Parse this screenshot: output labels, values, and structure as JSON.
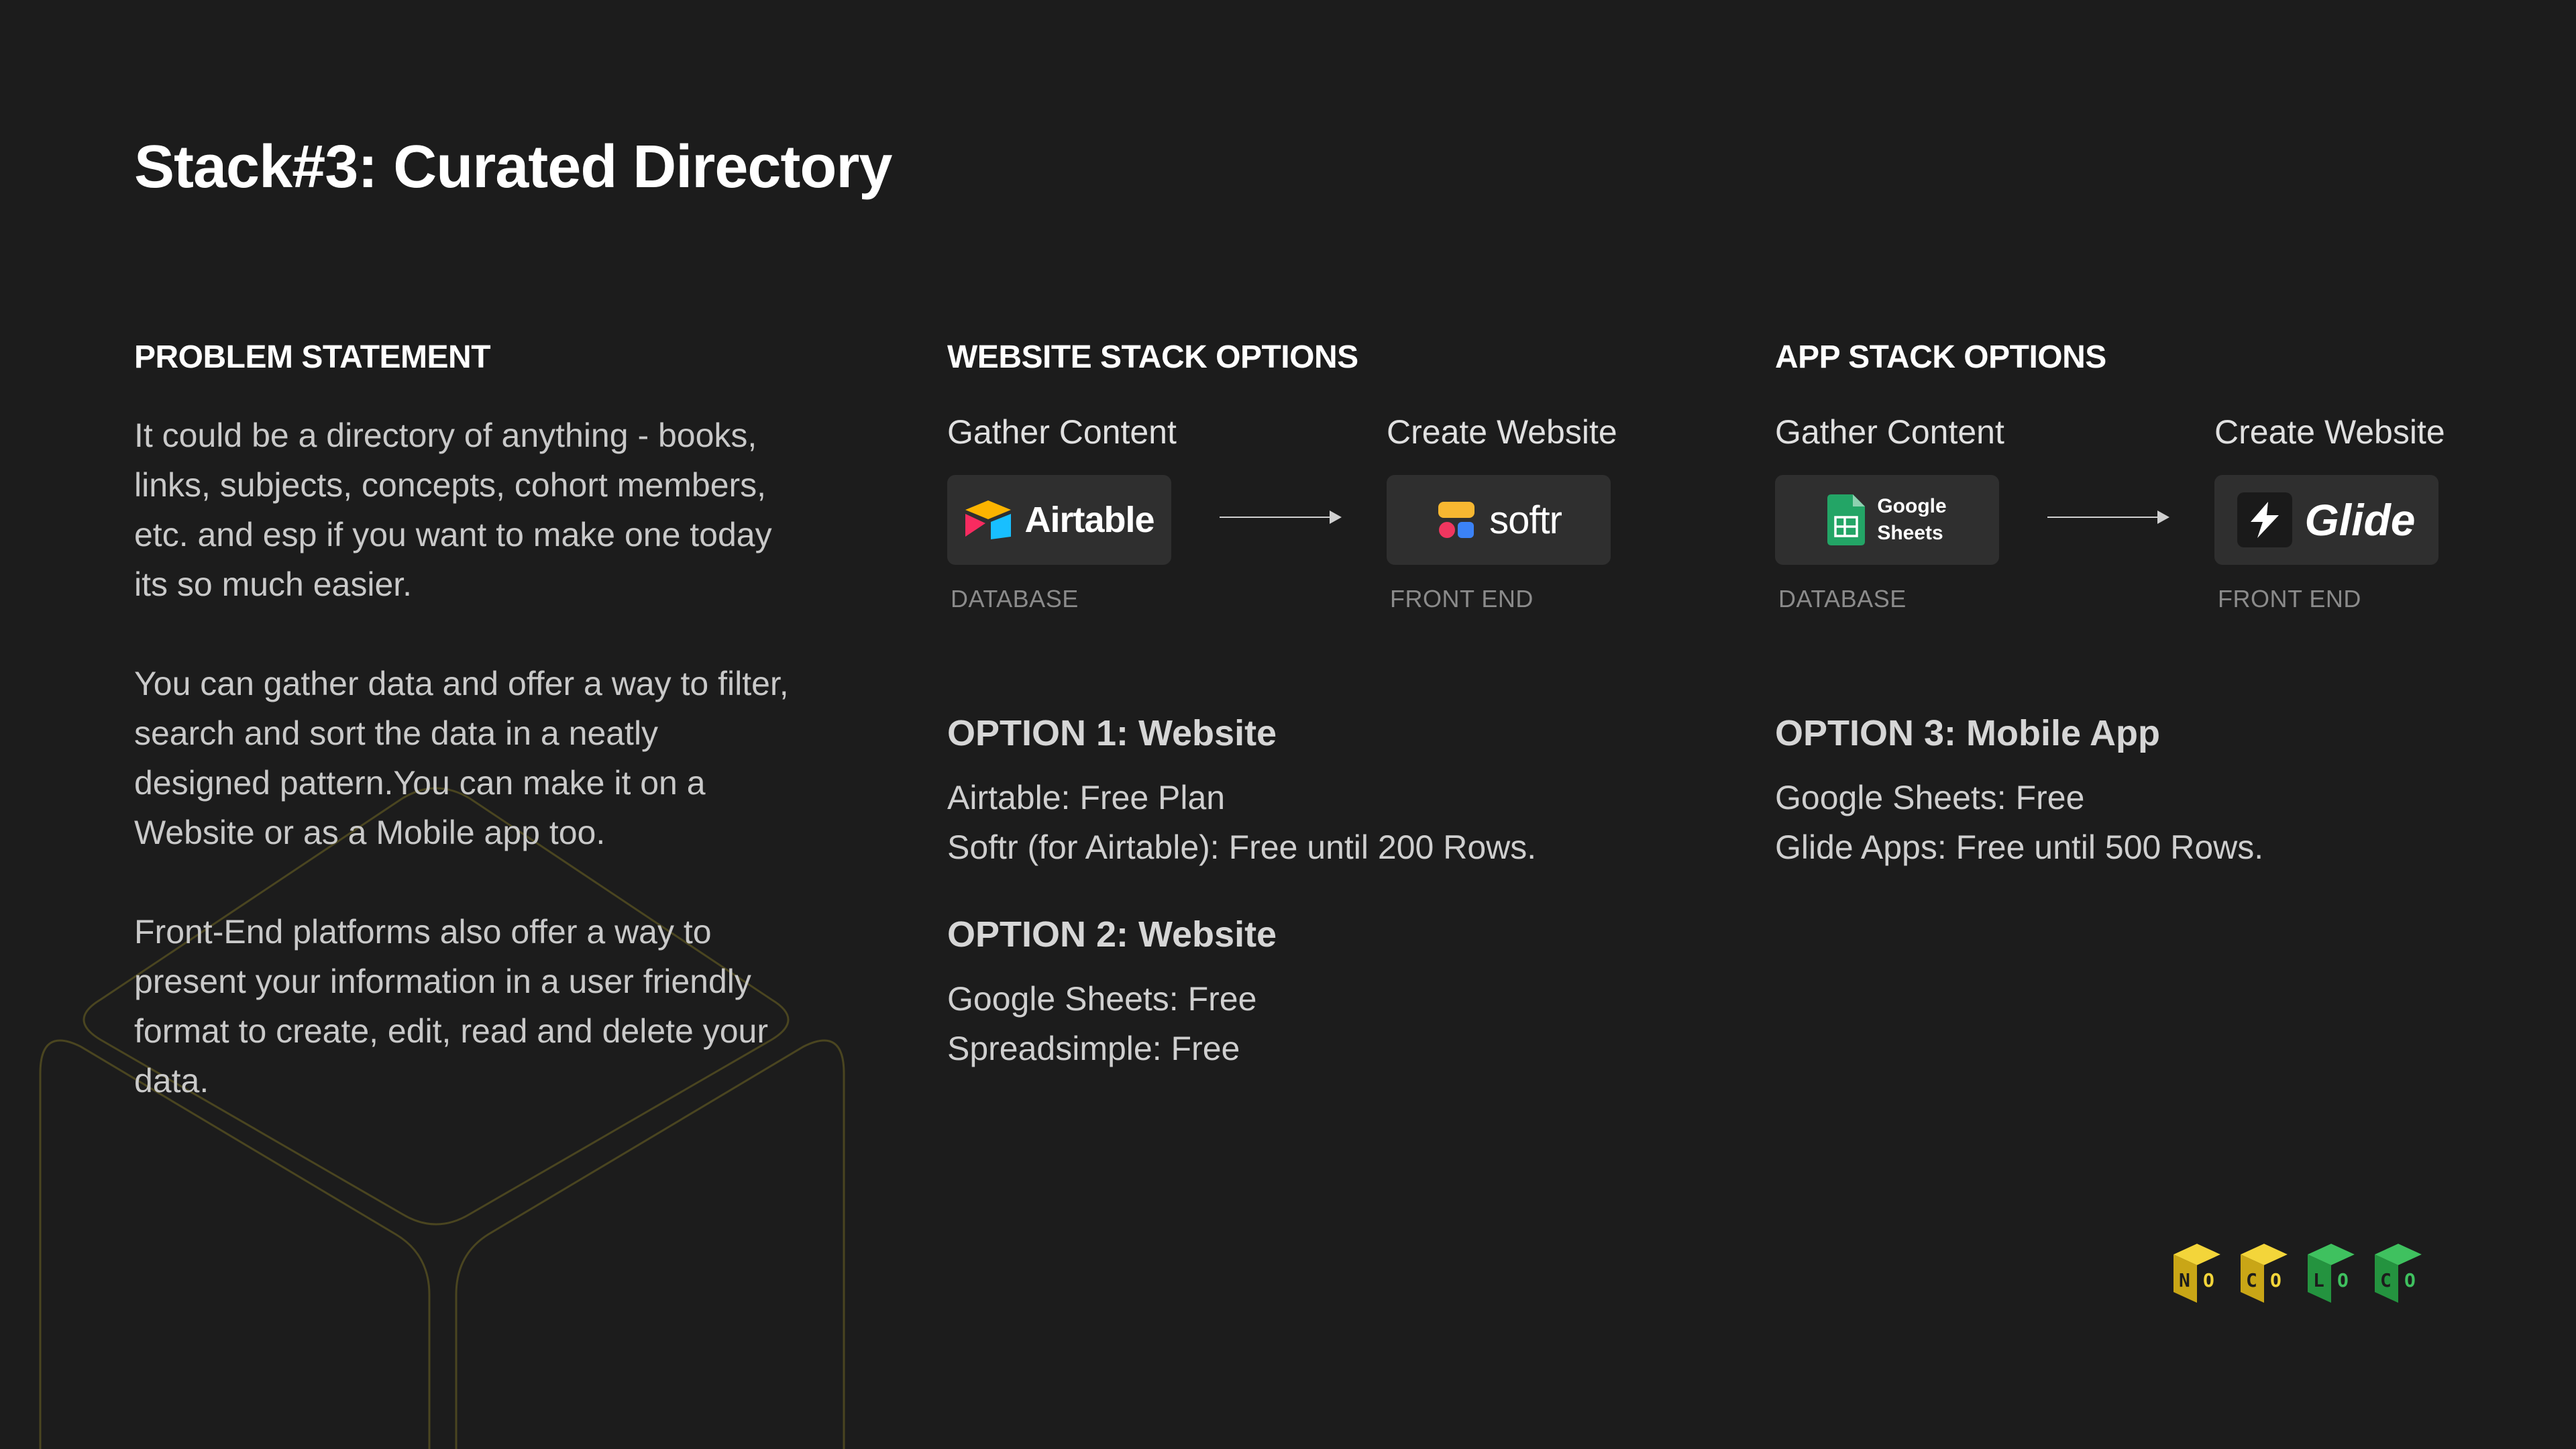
{
  "title": "Stack#3: Curated Directory",
  "problem": {
    "heading": "PROBLEM STATEMENT",
    "paragraphs": [
      "It could be a directory of anything - books, links, subjects, concepts, cohort members, etc. and esp if you want to make one today its so much easier.",
      "You can gather data and offer a way to filter, search and sort the data in a neatly designed pattern.You can make it on a Website or as a Mobile app too.",
      "Front-End platforms also offer a way to present your information in a user friendly format to create, edit, read and delete your data."
    ]
  },
  "website": {
    "heading": "WEBSITE STACK OPTIONS",
    "step1": "Gather Content",
    "step2": "Create Website",
    "db_name": "Airtable",
    "db_caption": "DATABASE",
    "fe_name": "softr",
    "fe_caption": "FRONT END",
    "option1": {
      "title": "OPTION 1: Website",
      "lines": [
        "Airtable: Free Plan",
        "Softr (for Airtable): Free until 200 Rows."
      ]
    },
    "option2": {
      "title": "OPTION 2: Website",
      "lines": [
        "Google Sheets: Free",
        "Spreadsimple: Free"
      ]
    }
  },
  "app": {
    "heading": "APP STACK OPTIONS",
    "step1": "Gather Content",
    "step2": "Create Website",
    "db_name_line1": "Google",
    "db_name_line2": "Sheets",
    "db_caption": "DATABASE",
    "fe_name": "Glide",
    "fe_caption": "FRONT END",
    "option3": {
      "title": "OPTION 3: Mobile App",
      "lines": [
        "Google Sheets: Free",
        "Glide Apps: Free until 500 Rows."
      ]
    }
  },
  "brand": {
    "letters": [
      "N",
      "O",
      "C",
      "O",
      "L",
      "O",
      "C",
      "O"
    ]
  },
  "colors": {
    "background": "#1c1c1c",
    "yellow": "#e2c21c",
    "green": "#2fa84f",
    "outline": "#4a4520"
  }
}
